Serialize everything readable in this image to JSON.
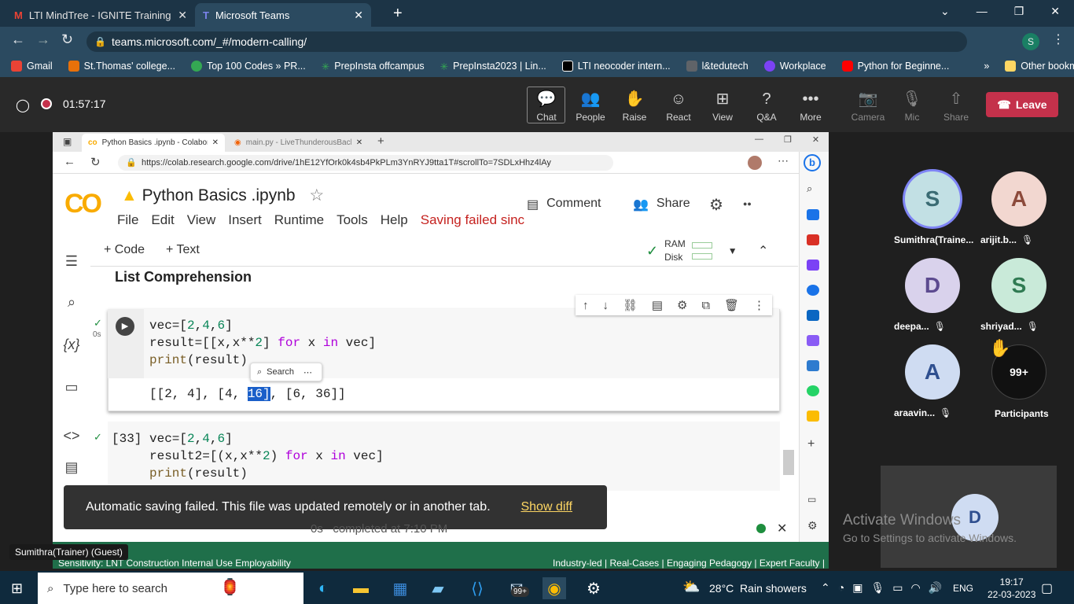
{
  "browser": {
    "tabs": [
      {
        "label": "LTI MindTree - IGNITE Training Pr"
      },
      {
        "label": "Microsoft Teams"
      }
    ],
    "url": "teams.microsoft.com/_#/modern-calling/",
    "bookmarks": [
      {
        "label": "Gmail",
        "color": "#ea4335"
      },
      {
        "label": "St.Thomas' college...",
        "color": "#e8710a"
      },
      {
        "label": "Top 100 Codes » PR...",
        "color": "#34a853"
      },
      {
        "label": "PrepInsta offcampus",
        "color": "#34a853"
      },
      {
        "label": "PrepInsta2023 | Lin...",
        "color": "#34a853"
      },
      {
        "label": "LTI neocoder intern...",
        "color": "#1a1a1a"
      },
      {
        "label": "l&tedutech",
        "color": "#5f6368"
      },
      {
        "label": "Workplace",
        "color": "#7b42f5"
      },
      {
        "label": "Python for Beginne...",
        "color": "#ff0000"
      }
    ],
    "other_bookmarks": "Other bookmarks",
    "profile_initial": "S"
  },
  "teams": {
    "timer": "01:57:17",
    "buttons": [
      {
        "label": "Chat",
        "icon": "chat-icon",
        "glyph": "💬"
      },
      {
        "label": "People",
        "icon": "people-icon",
        "glyph": "👥"
      },
      {
        "label": "Raise",
        "icon": "raise-hand-icon",
        "glyph": "✋"
      },
      {
        "label": "React",
        "icon": "react-icon",
        "glyph": "☺"
      },
      {
        "label": "View",
        "icon": "view-icon",
        "glyph": "⊞"
      },
      {
        "label": "Q&A",
        "icon": "qa-icon",
        "glyph": "?"
      },
      {
        "label": "More",
        "icon": "more-icon",
        "glyph": "•••"
      },
      {
        "label": "Camera",
        "icon": "camera-off-icon",
        "glyph": "📷"
      },
      {
        "label": "Mic",
        "icon": "mic-off-icon",
        "glyph": "🎙"
      },
      {
        "label": "Share",
        "icon": "share-icon",
        "glyph": "⇧"
      }
    ],
    "leave": "Leave",
    "participants": [
      {
        "initial": "S",
        "name": "Sumithra(Traine...",
        "bg": "#c2e0e4",
        "fg": "#3a6b73"
      },
      {
        "initial": "A",
        "name": "arijit.b...",
        "bg": "#f2d7d0",
        "fg": "#8c4a3b"
      },
      {
        "initial": "D",
        "name": "deepa...",
        "bg": "#d9d2ec",
        "fg": "#5c4a8f"
      },
      {
        "initial": "S",
        "name": "shriyad...",
        "bg": "#c9ead9",
        "fg": "#2f7a52"
      },
      {
        "initial": "A",
        "name": "araavin...",
        "bg": "#cfdcf2",
        "fg": "#2f4f8f"
      }
    ],
    "overflow_count": "99+",
    "participants_label": "Participants",
    "presenter_label": "Sumithra(Trainer) (Guest)",
    "watermark_title": "Activate Windows",
    "watermark_sub": "Go to Settings to activate Windows.",
    "small_avatar": "D"
  },
  "shared": {
    "edge_tabs": [
      {
        "label": "Python Basics .ipynb - Colaborat"
      },
      {
        "label": "main.py - LiveThunderousBacke"
      }
    ],
    "edge_url": "https://colab.research.google.com/drive/1hE12YfOrk0k4sb4PkPLm3YnRYJ9tta1T#scrollTo=7SDLxHhz4lAy",
    "notebook_title": "Python Basics .ipynb",
    "menu": [
      "File",
      "Edit",
      "View",
      "Insert",
      "Runtime",
      "Tools",
      "Help"
    ],
    "saving_warning": "Saving failed sinc",
    "comment": "Comment",
    "share": "Share",
    "add_code": "+ Code",
    "add_text": "+ Text",
    "ram": "RAM",
    "disk": "Disk",
    "section_heading": "List Comprehension",
    "cell1": {
      "status_time": "0s",
      "lines": [
        "vec=[2,4,6]",
        "result=[[x,x**2] for x in vec]",
        "print(result)"
      ],
      "output_pre": "[[2, 4], [4, ",
      "output_sel": "16]",
      "output_post": ", [6, 36]]",
      "search_popup": "Search"
    },
    "cell2": {
      "exec_count": "[33]",
      "lines": [
        "vec=[2,4,6]",
        "result2=[(x,x**2) for x in vec]",
        "print(result)"
      ]
    },
    "snackbar": {
      "message": "Automatic saving failed. This file was updated remotely or in another tab.",
      "action": "Show diff"
    },
    "status_line": "0s   completed at 7:10 PM",
    "bottom_left": "Sensitivity: LNT Construction Internal Use Employability",
    "bottom_right": "Industry-led | Real-Cases | Engaging Pedagogy | Expert Faculty |"
  },
  "taskbar": {
    "search_placeholder": "Type here to search",
    "weather": "28°C  Rain showers",
    "lang": "ENG",
    "time": "19:17",
    "date": "22-03-2023",
    "mail_badge": "99+"
  }
}
